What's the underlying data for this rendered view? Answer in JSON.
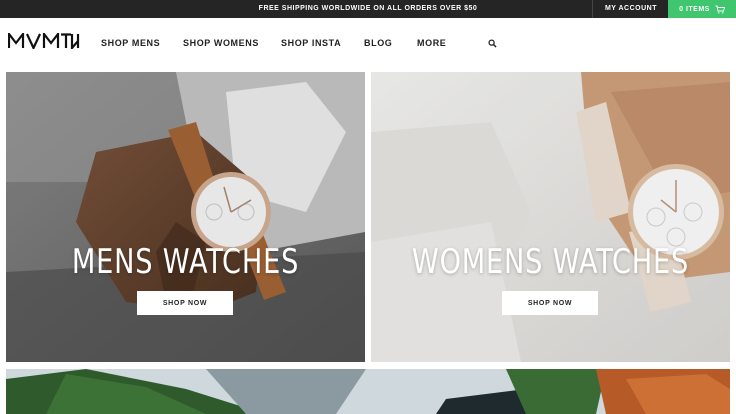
{
  "topbar": {
    "promo_text": "FREE SHIPPING WORLDWIDE ON ALL ORDERS OVER $50",
    "account_label": "MY ACCOUNT",
    "cart_label": "0 ITEMS",
    "cart_icon": "cart-icon",
    "colors": {
      "background": "#252525",
      "cart_background": "#3fc66f"
    }
  },
  "nav": {
    "logo_text": "MVMT",
    "items": [
      "SHOP MENS",
      "SHOP WOMENS",
      "SHOP INSTA",
      "BLOG",
      "MORE"
    ],
    "search_icon": "search-icon"
  },
  "hero": {
    "mens": {
      "title": "MENS WATCHES",
      "button": "SHOP NOW"
    },
    "womens": {
      "title": "WOMENS WATCHES",
      "button": "SHOP NOW"
    }
  },
  "lower_banner": {
    "image": "landscape-photo"
  }
}
